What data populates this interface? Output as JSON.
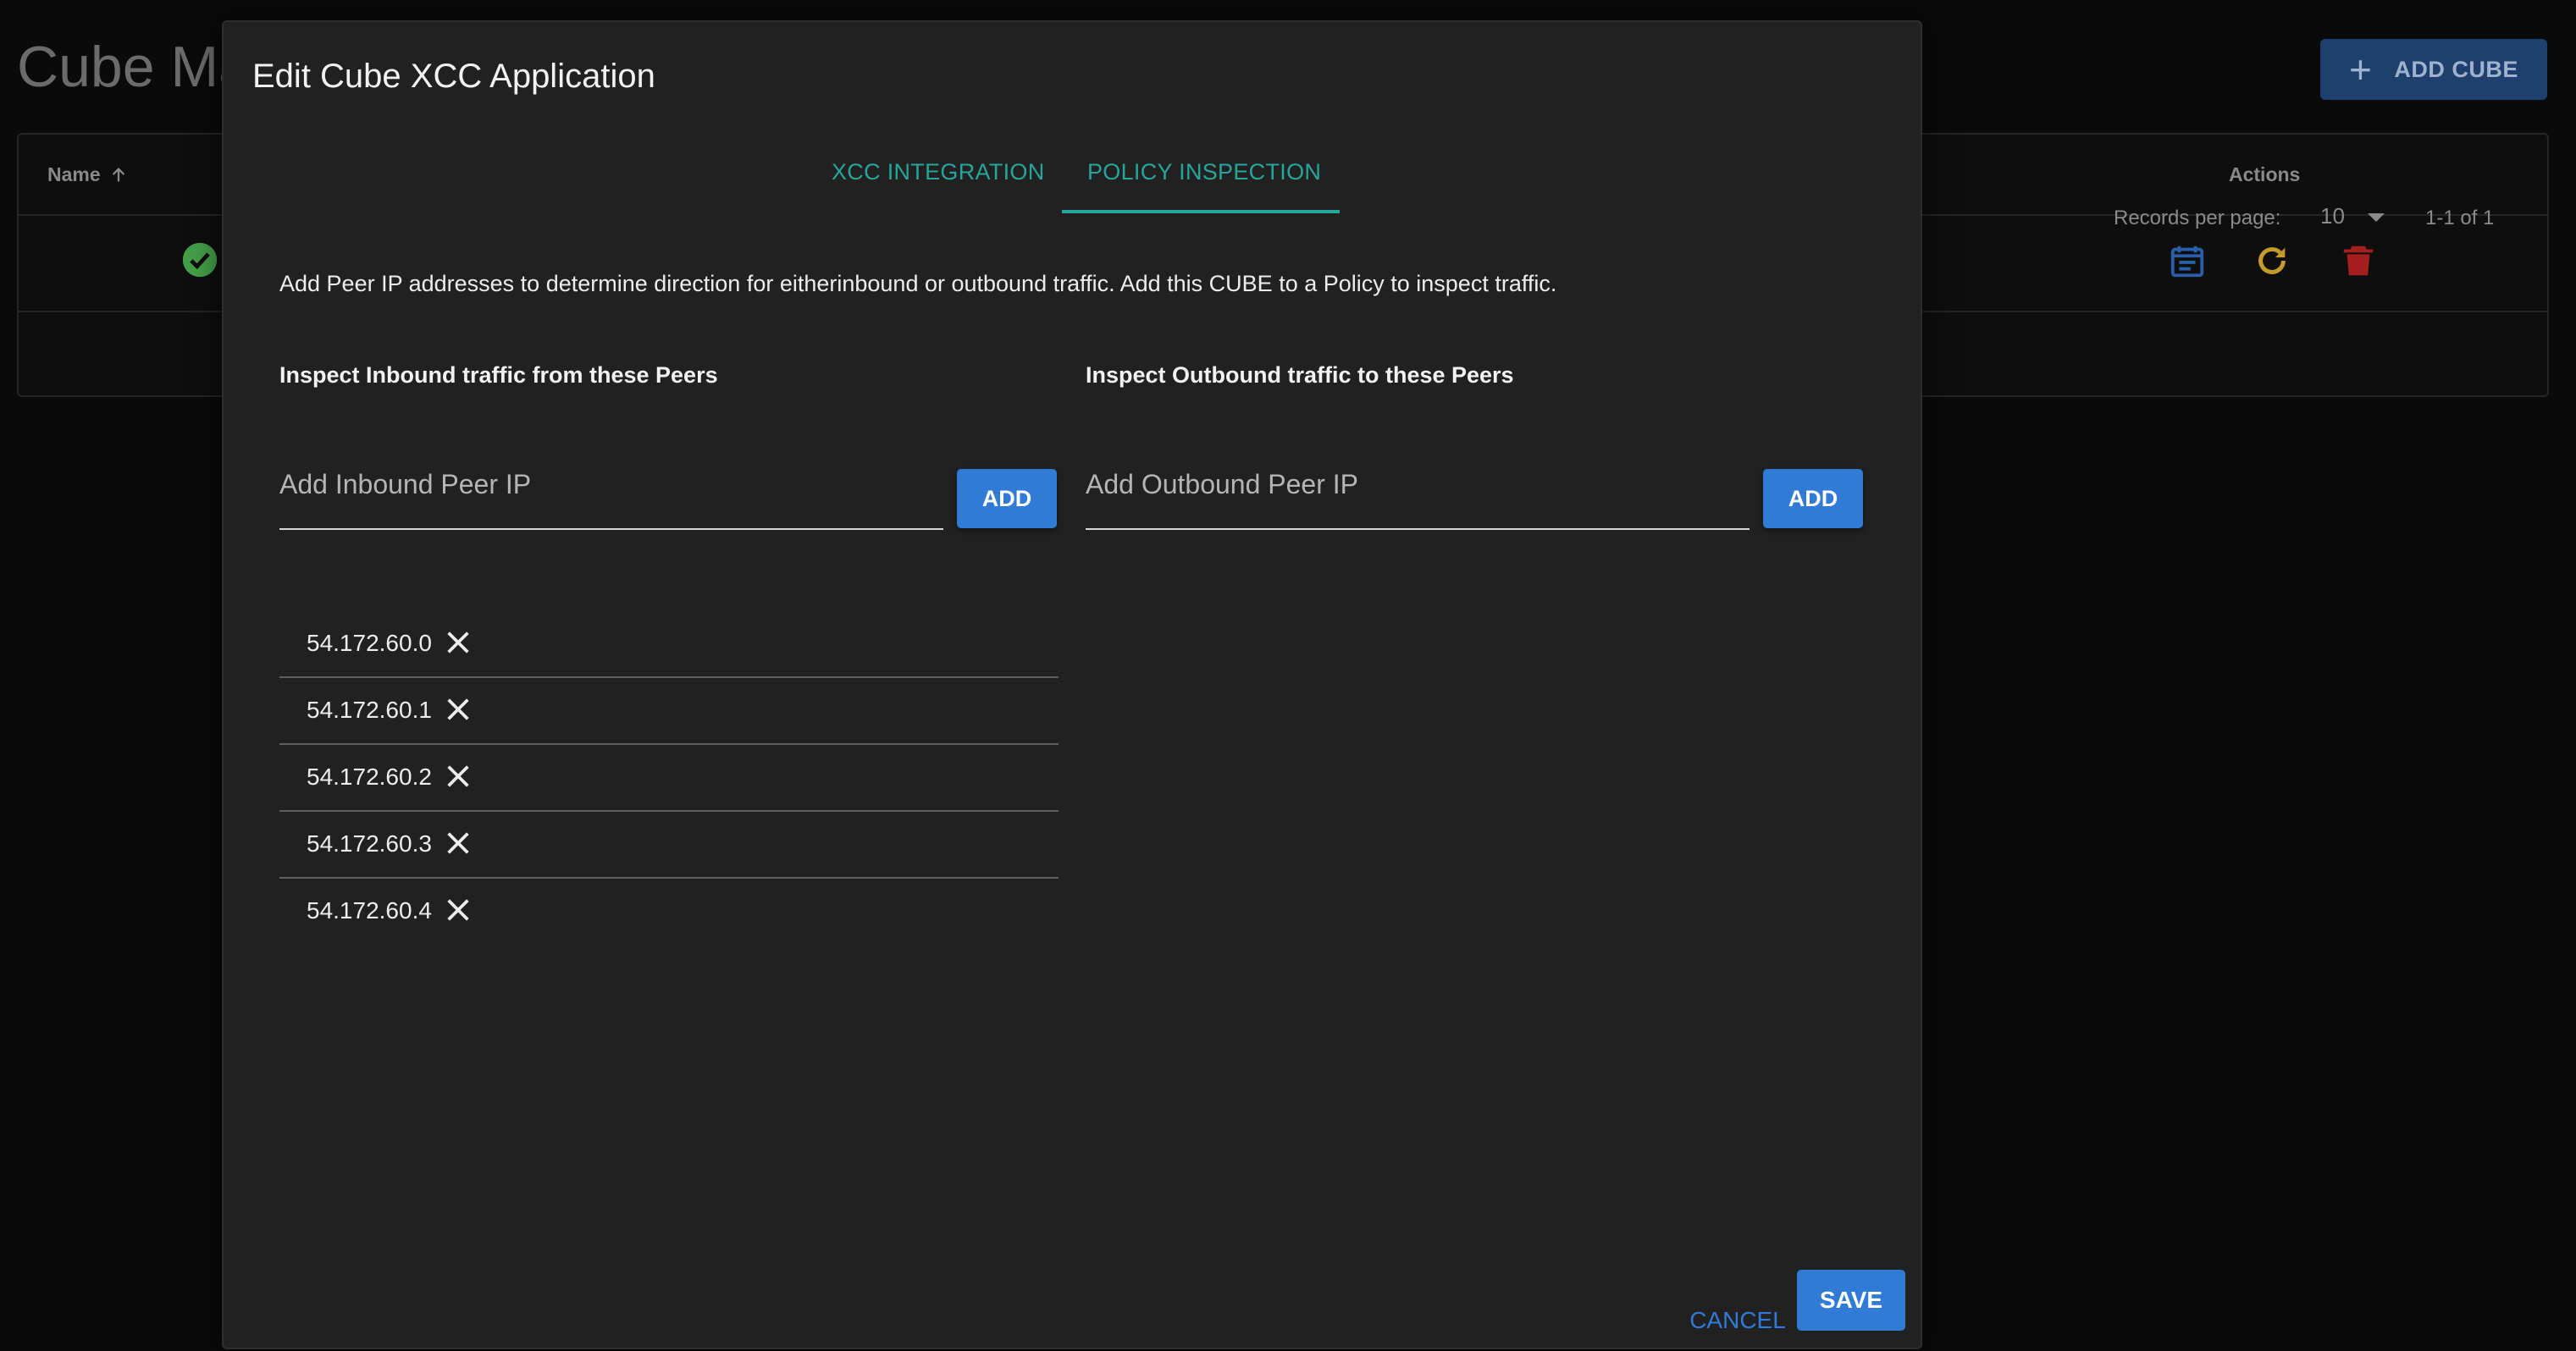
{
  "background": {
    "page_title": "Cube Ma",
    "add_cube_label": "ADD CUBE",
    "table": {
      "col_name": "Name",
      "col_actions": "Actions",
      "records_per_page_label": "Records per page:",
      "records_per_page_value": "10",
      "range": "1-1 of 1"
    }
  },
  "dialog": {
    "title": "Edit Cube XCC Application",
    "tabs": [
      {
        "label": "XCC INTEGRATION",
        "active": false
      },
      {
        "label": "POLICY INSPECTION",
        "active": true
      }
    ],
    "description": "Add Peer IP addresses to determine direction for eitherinbound or outbound traffic. Add this CUBE to a Policy to inspect traffic.",
    "inbound": {
      "heading": "Inspect Inbound traffic from these Peers",
      "placeholder": "Add Inbound Peer IP",
      "add_label": "ADD",
      "peers": [
        "54.172.60.0",
        "54.172.60.1",
        "54.172.60.2",
        "54.172.60.3",
        "54.172.60.4"
      ]
    },
    "outbound": {
      "heading": "Inspect Outbound traffic to these Peers",
      "placeholder": "Add Outbound Peer IP",
      "add_label": "ADD",
      "peers": []
    },
    "cancel_label": "CANCEL",
    "save_label": "SAVE"
  },
  "colors": {
    "accent": "#2f7bd6",
    "tab_accent": "#26a69a",
    "success": "#43a047",
    "warning": "#c49a2c",
    "danger": "#a51f1f"
  },
  "icons": {
    "status": "check-circle-icon",
    "sort": "arrow-up-icon",
    "actions": [
      "calendar-icon",
      "refresh-icon",
      "trash-icon"
    ],
    "remove": "close-icon",
    "add": "plus-icon",
    "dropdown": "caret-down-icon"
  }
}
